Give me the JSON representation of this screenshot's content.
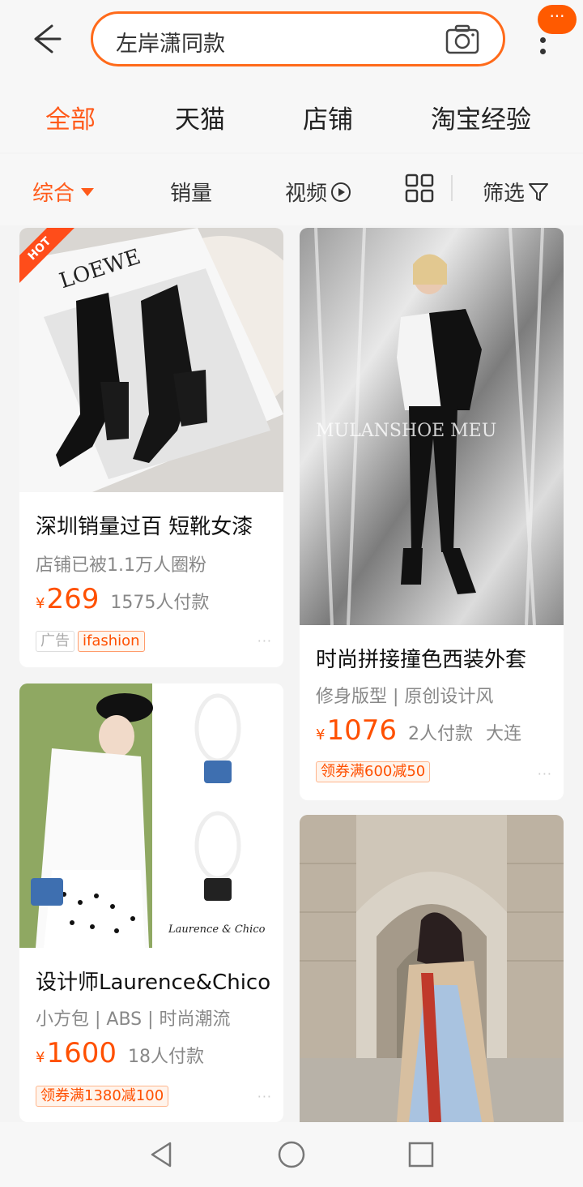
{
  "search": {
    "query": "左岸潇同款"
  },
  "header": {
    "more_badge": "···"
  },
  "tabs": [
    {
      "label": "全部"
    },
    {
      "label": "天猫"
    },
    {
      "label": "店铺"
    },
    {
      "label": "淘宝经验"
    }
  ],
  "sort": {
    "comprehensive": "综合",
    "sales": "销量",
    "video": "视频",
    "filter": "筛选"
  },
  "products": [
    {
      "title": "深圳销量过百 短靴女漆",
      "subtitle": "店铺已被1.1万人圈粉",
      "currency": "¥",
      "price": "269",
      "paid": "1575人付款",
      "location": "",
      "tags": [
        "广告",
        "ifashion"
      ],
      "hot": "HOT",
      "image_text": "LOEWE",
      "more": "···"
    },
    {
      "title": "时尚拼接撞色西装外套",
      "subtitle": "修身版型 | 原创设计风",
      "currency": "¥",
      "price": "1076",
      "paid": "2人付款",
      "location": "大连",
      "tags": [
        "领券满600减50"
      ],
      "image_text": "MULANSHOE MEU",
      "more": "···"
    },
    {
      "title": "设计师Laurence&Chico",
      "subtitle": "小方包 | ABS | 时尚潮流",
      "currency": "¥",
      "price": "1600",
      "paid": "18人付款",
      "location": "",
      "tags": [
        "领券满1380减100"
      ],
      "image_text": "Laurence & Chico",
      "more": "···"
    }
  ],
  "colors": {
    "accent": "#ff5000",
    "active_tab": "#ff5a1a"
  }
}
